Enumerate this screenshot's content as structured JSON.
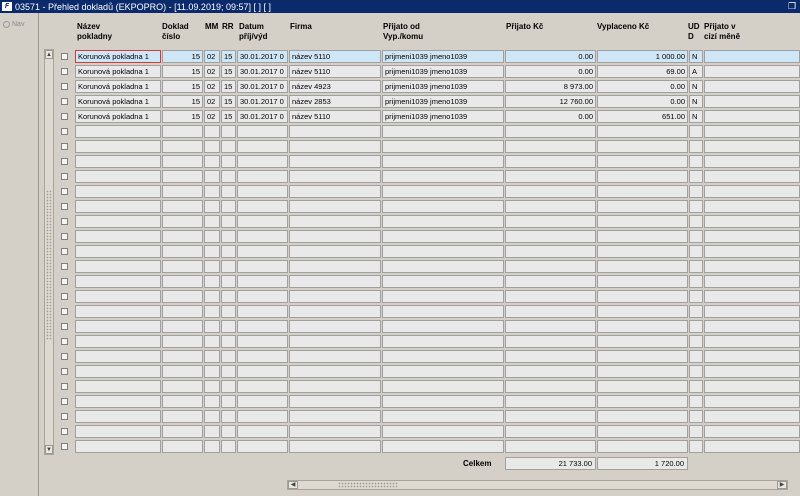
{
  "window": {
    "title": "03571 - Přehled dokladů (EKPOPRO) - [11.09.2019; 09:57]  [ ]  [ ]",
    "logo": "F"
  },
  "left_panel": {
    "nav_label": "Nav"
  },
  "columns": {
    "nazev": "Název\npokladny",
    "doklad": "Doklad\nčíslo",
    "mm": "MM",
    "rr": "RR",
    "datum": "Datum\npříj/výd",
    "firma": "Firma",
    "prijato_od": "Přijato od\nVyp./komu",
    "prijato_kc": "Přijato Kč",
    "vyplaceno_kc": "Vyplaceno Kč",
    "ud": "UD\nD",
    "prijato_v": "Přijato v\ncizí měně"
  },
  "rows": [
    {
      "nazev": "Korunová pokladna 1",
      "doklad": "15",
      "mm": "02",
      "rr": "15",
      "datum": "30.01.2017 0",
      "firma": "název 5110",
      "prijato_od": "prijmeni1039 jmeno1039",
      "prijato_kc": "0.00",
      "vyplaceno_kc": "1 000.00",
      "ud": "N",
      "prijato_v": ""
    },
    {
      "nazev": "Korunová pokladna 1",
      "doklad": "15",
      "mm": "02",
      "rr": "15",
      "datum": "30.01.2017 0",
      "firma": "název 5110",
      "prijato_od": "prijmeni1039 jmeno1039",
      "prijato_kc": "0.00",
      "vyplaceno_kc": "69.00",
      "ud": "A",
      "prijato_v": ""
    },
    {
      "nazev": "Korunová pokladna 1",
      "doklad": "15",
      "mm": "02",
      "rr": "15",
      "datum": "30.01.2017 0",
      "firma": "název 4923",
      "prijato_od": "prijmeni1039 jmeno1039",
      "prijato_kc": "8 973.00",
      "vyplaceno_kc": "0.00",
      "ud": "N",
      "prijato_v": ""
    },
    {
      "nazev": "Korunová pokladna 1",
      "doklad": "15",
      "mm": "02",
      "rr": "15",
      "datum": "30.01.2017 0",
      "firma": "název 2853",
      "prijato_od": "prijmeni1039 jmeno1039",
      "prijato_kc": "12 760.00",
      "vyplaceno_kc": "0.00",
      "ud": "N",
      "prijato_v": ""
    },
    {
      "nazev": "Korunová pokladna 1",
      "doklad": "15",
      "mm": "02",
      "rr": "15",
      "datum": "30.01.2017 0",
      "firma": "název 5110",
      "prijato_od": "prijmeni1039 jmeno1039",
      "prijato_kc": "0.00",
      "vyplaceno_kc": "651.00",
      "ud": "N",
      "prijato_v": ""
    }
  ],
  "empty_rows": 22,
  "totals": {
    "label": "Celkem",
    "prijato_kc": "21 733.00",
    "vyplaceno_kc": "1 720.00"
  },
  "icons": {
    "scroll_up": "up-arrow-icon",
    "scroll_down": "down-arrow-icon",
    "scroll_left": "left-arrow-icon",
    "scroll_right": "right-arrow-icon",
    "restore": "restore-window-icon"
  }
}
